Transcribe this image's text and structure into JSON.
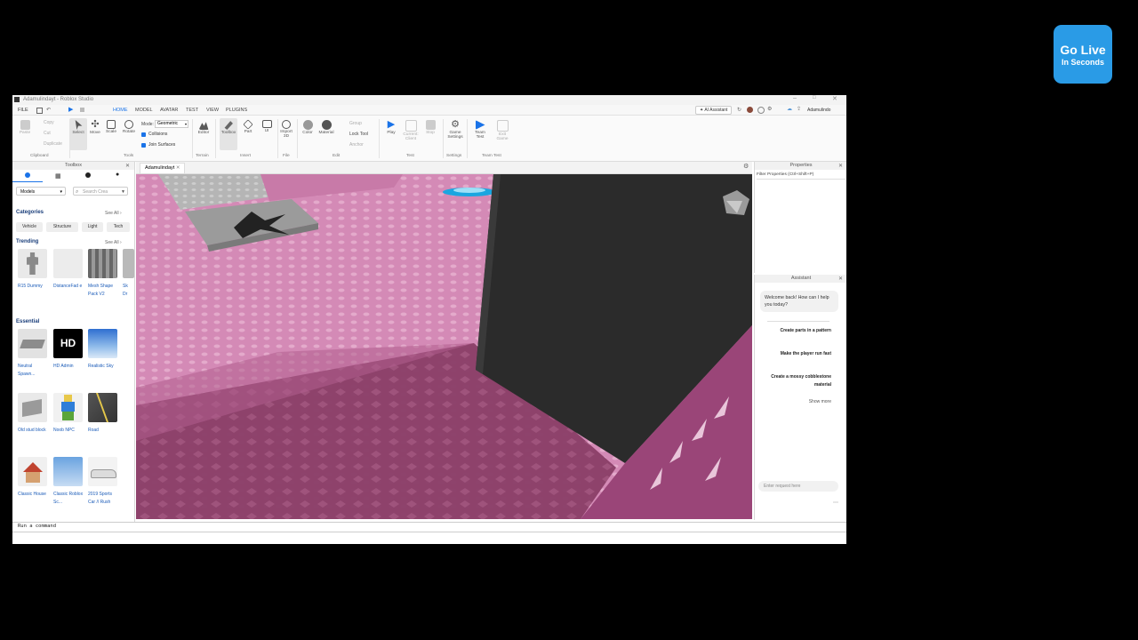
{
  "window": {
    "title": "Adamulindayt - Roblox Studio"
  },
  "menu": {
    "file": "FILE",
    "tabs": [
      "HOME",
      "MODEL",
      "AVATAR",
      "TEST",
      "VIEW",
      "PLUGINS"
    ],
    "ai_assistant": "AI Assistant",
    "user": "Adamulindo"
  },
  "ribbon": {
    "clipboard": {
      "items": [
        "Copy",
        "Cut",
        "Duplicate"
      ],
      "paste": "Paste",
      "label": "Clipboard"
    },
    "tools": {
      "items": [
        "Select",
        "Move",
        "Scale",
        "Rotate"
      ],
      "mode_label": "Mode:",
      "mode_value": "Geometric",
      "collisions": "Collisions",
      "join_surfaces": "Join Surfaces",
      "label": "Tools"
    },
    "terrain": {
      "items": [
        "Editor"
      ],
      "label": "Terrain"
    },
    "insert": {
      "items": [
        "Toolbox",
        "Part",
        "UI"
      ],
      "label": "Insert"
    },
    "file": {
      "items": [
        "Import 3D"
      ],
      "label": "File"
    },
    "edit": {
      "items": [
        "Color",
        "Material"
      ],
      "group": "Group",
      "lock_tool": "Lock Tool",
      "anchor": "Anchor",
      "label": "Edit"
    },
    "test": {
      "items": [
        "Play",
        "Current: Client",
        "Stop"
      ],
      "label": "Test"
    },
    "settings": {
      "items": [
        "Game Settings"
      ],
      "label": "Settings"
    },
    "team_test": {
      "items": [
        "Team Test",
        "Exit Game"
      ],
      "label": "Team Test"
    }
  },
  "toolbox": {
    "title": "Toolbox",
    "dropdown": "Models",
    "search_placeholder": "Search Crea",
    "categories_title": "Categories",
    "see_all": "See All",
    "categories": [
      "Vehicle",
      "Structure",
      "Light",
      "Tech"
    ],
    "trending_title": "Trending",
    "trending": [
      {
        "label": "R15 Dummy"
      },
      {
        "label": "DistanceFad e"
      },
      {
        "label": "Mesh Shape Pack V2"
      },
      {
        "label": "Sk Dr"
      }
    ],
    "essential_title": "Essential",
    "essential": [
      {
        "label": "Neutral Spawn..."
      },
      {
        "label": "HD Admin",
        "badge": "HD"
      },
      {
        "label": "Realistic Sky"
      },
      {
        "label": "Old stud block"
      },
      {
        "label": "Noob NPC"
      },
      {
        "label": "Road"
      },
      {
        "label": "Classic House"
      },
      {
        "label": "Classic Roblox Sc..."
      },
      {
        "label": "2019 Sports Car // Rush"
      }
    ]
  },
  "viewport": {
    "tab": "Adamulindayt"
  },
  "properties": {
    "title": "Properties",
    "filter_placeholder": "Filter Properties (Ctrl+Shift+P)"
  },
  "assistant": {
    "title": "Assistant",
    "welcome": "Welcome back! How can I help you today?",
    "suggestions": [
      "Create parts in a pattern",
      "Make the player run fast",
      "Create a mossy cobblestone material"
    ],
    "show_more": "Show more",
    "input_placeholder": "Enter request here"
  },
  "command_bar": {
    "placeholder": "Run a command"
  },
  "overlay": {
    "line1": "Go Live",
    "line2": "In Seconds"
  },
  "colors": {
    "accent": "#1a73e8",
    "floor": "#d88fb8",
    "wall": "#2a2a2a",
    "go_live": "#2a9be6"
  }
}
